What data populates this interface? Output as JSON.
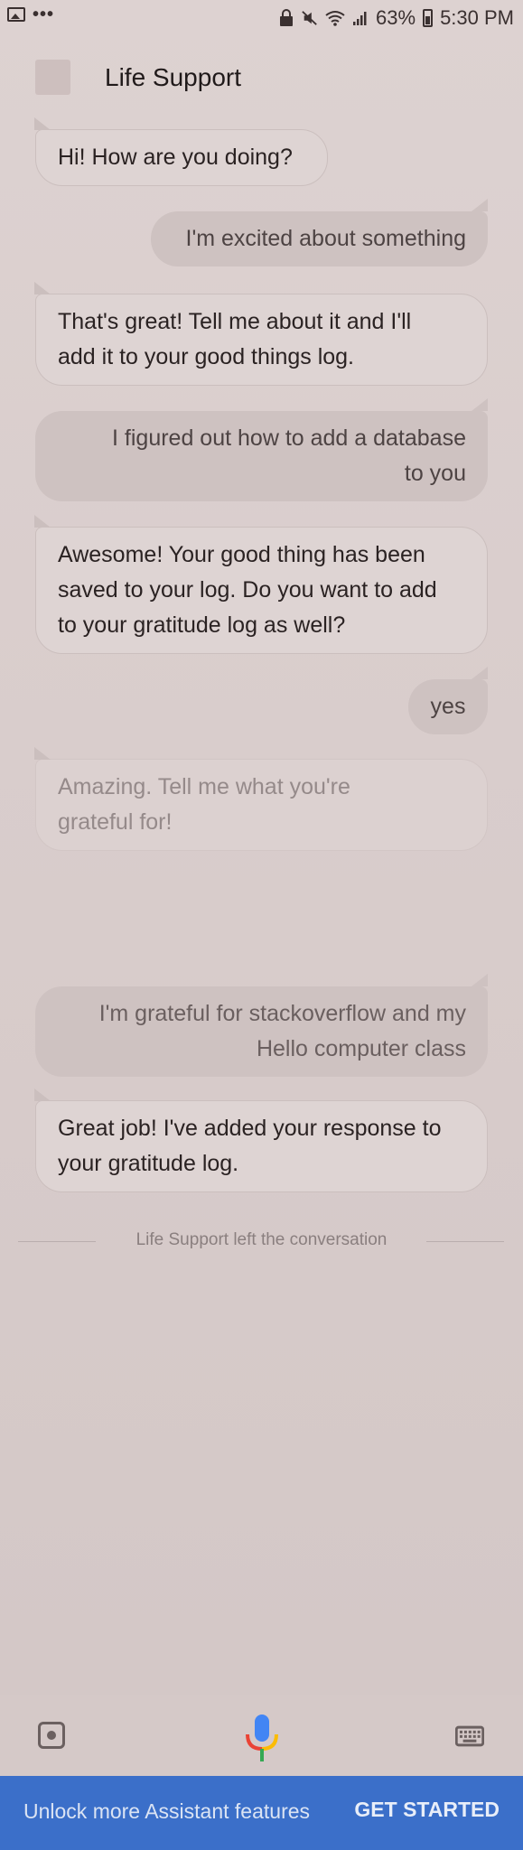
{
  "status_bar": {
    "battery": "63%",
    "time": "5:30 PM",
    "icons": [
      "image-icon",
      "more-dots-icon",
      "lock-icon",
      "mute-icon",
      "wifi-icon",
      "signal-icon",
      "battery-icon"
    ]
  },
  "header": {
    "title": "Life Support"
  },
  "messages": [
    {
      "from": "bot",
      "text": "Hi! How are you doing?"
    },
    {
      "from": "user",
      "text": "I'm excited about something"
    },
    {
      "from": "bot",
      "line1": "That's great! Tell me about it and I'll",
      "line2": "add it to your good things log."
    },
    {
      "from": "user",
      "line1": "I figured out how to add a database",
      "line2": "to you"
    },
    {
      "from": "bot",
      "line1": "Awesome! Your good thing has been",
      "line2": "saved to your log. Do you want to add",
      "line3": "to your gratitude log as well?"
    },
    {
      "from": "user",
      "text": "yes"
    },
    {
      "from": "bot",
      "line1": "Amazing. Tell me what you're",
      "line2": "grateful for!"
    },
    {
      "from": "user",
      "line1": "I'm grateful for stackoverflow and my",
      "line2": "Hello computer class"
    },
    {
      "from": "bot",
      "line1": "Great job! I've added your response to",
      "line2": "your gratitude log."
    }
  ],
  "divider_text": "Life Support left the conversation",
  "toolbar": {
    "icons": [
      "lens-icon",
      "mic-icon",
      "keyboard-icon"
    ]
  },
  "banner": {
    "text": "Unlock more Assistant features",
    "button": "GET STARTED",
    "color": "#3b6fc9"
  },
  "colors": {
    "mic_blue": "#4285f4",
    "mic_red": "#ea4335",
    "mic_yellow": "#fbbc05",
    "mic_green": "#34a853"
  }
}
